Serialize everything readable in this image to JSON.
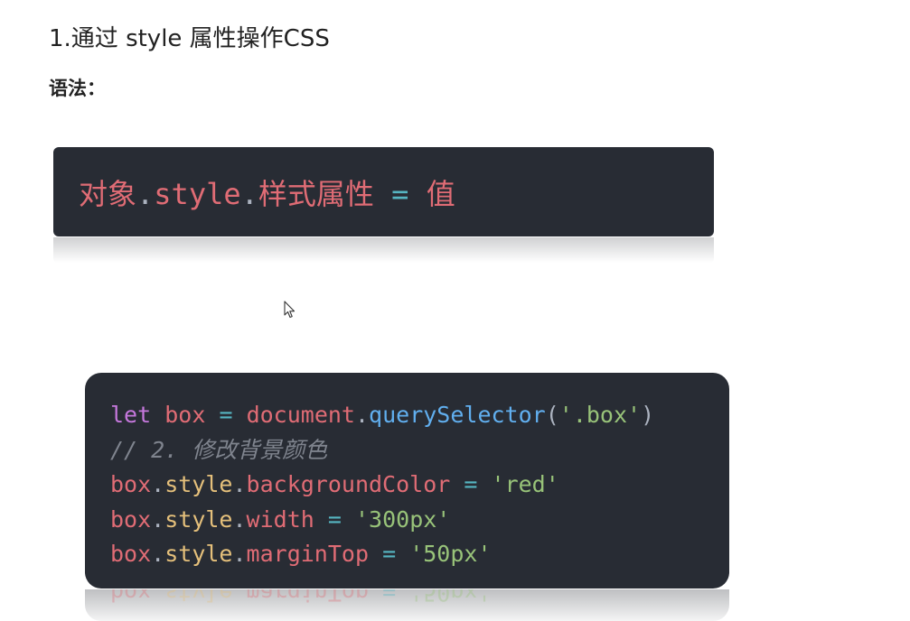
{
  "heading": "1.通过 style 属性操作CSS",
  "syntax_label": "语法：",
  "syntax_code": {
    "obj": "对象",
    "dot1": ".",
    "style": "style",
    "dot2": ".",
    "prop": "样式属性",
    "eq": "=",
    "val": "值"
  },
  "example_code": {
    "line1": {
      "kw": "let",
      "var": "box",
      "eq": "=",
      "obj": "document",
      "dot": ".",
      "method": "querySelector",
      "lparen": "(",
      "str": "'.box'",
      "rparen": ")"
    },
    "line2": {
      "comment": "// 2. 修改背景颜色"
    },
    "line3": {
      "obj": "box",
      "dot1": ".",
      "style": "style",
      "dot2": ".",
      "prop": "backgroundColor",
      "eq": "=",
      "str": "'red'"
    },
    "line4": {
      "obj": "box",
      "dot1": ".",
      "style": "style",
      "dot2": ".",
      "prop": "width",
      "eq": "=",
      "str": "'300px'"
    },
    "line5": {
      "obj": "box",
      "dot1": ".",
      "style": "style",
      "dot2": ".",
      "prop": "marginTop",
      "eq": "=",
      "str": "'50px'"
    }
  },
  "colors": {
    "code_bg": "#282c34",
    "red": "#e06c75",
    "purple": "#c678dd",
    "cyan": "#56b6c2",
    "blue": "#61afef",
    "green": "#98c379",
    "comment": "#7f848e"
  },
  "icons": {
    "cursor": "mouse-pointer-icon"
  }
}
